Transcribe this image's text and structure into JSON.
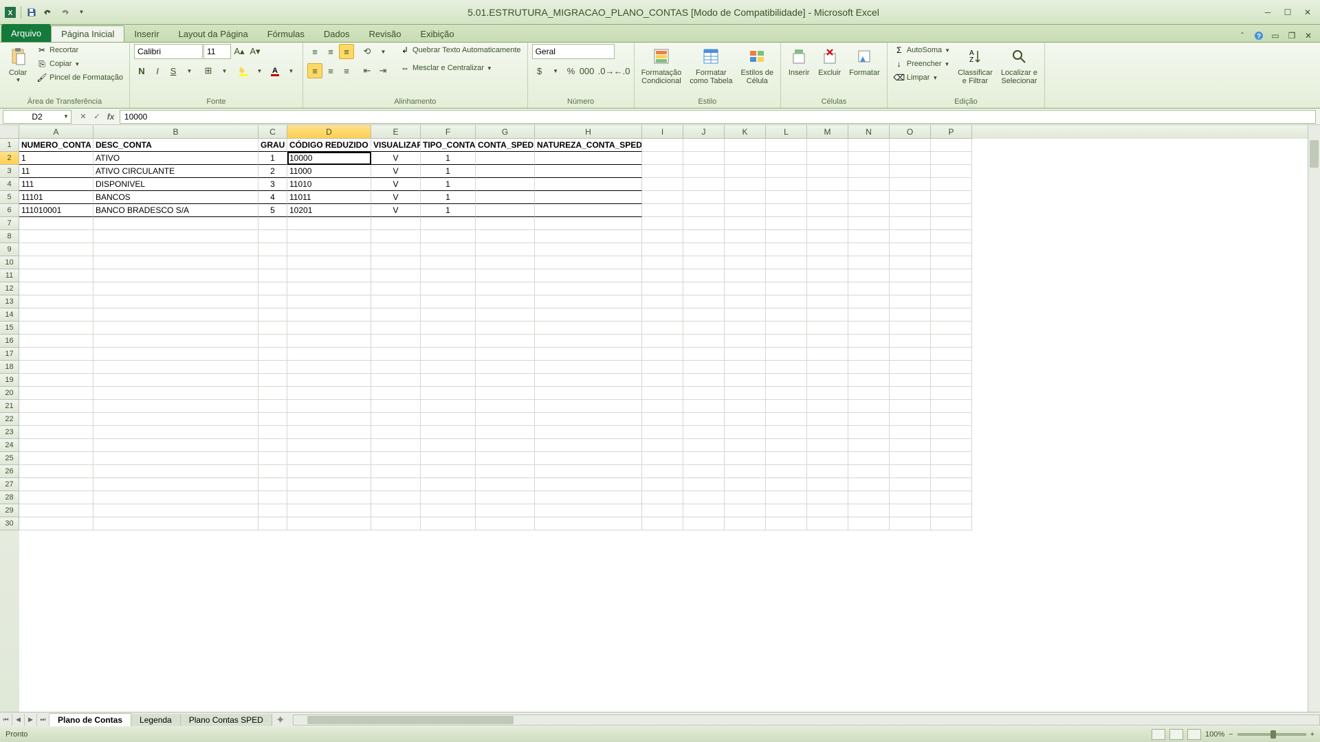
{
  "title": "5.01.ESTRUTURA_MIGRACAO_PLANO_CONTAS [Modo de Compatibilidade] - Microsoft Excel",
  "tabs": {
    "file": "Arquivo",
    "home": "Página Inicial",
    "insert": "Inserir",
    "layout": "Layout da Página",
    "formulas": "Fórmulas",
    "data": "Dados",
    "review": "Revisão",
    "view": "Exibição"
  },
  "ribbon": {
    "clipboard": {
      "paste": "Colar",
      "cut": "Recortar",
      "copy": "Copiar",
      "painter": "Pincel de Formatação",
      "group": "Área de Transferência"
    },
    "font": {
      "name": "Calibri",
      "size": "11",
      "group": "Fonte"
    },
    "align": {
      "wrap": "Quebrar Texto Automaticamente",
      "merge": "Mesclar e Centralizar",
      "group": "Alinhamento"
    },
    "number": {
      "format": "Geral",
      "group": "Número"
    },
    "styles": {
      "cond": "Formatação\nCondicional",
      "table": "Formatar\ncomo Tabela",
      "cell": "Estilos de\nCélula",
      "group": "Estilo"
    },
    "cells": {
      "insert": "Inserir",
      "delete": "Excluir",
      "format": "Formatar",
      "group": "Células"
    },
    "editing": {
      "sum": "AutoSoma",
      "fill": "Preencher",
      "clear": "Limpar",
      "sort": "Classificar\ne Filtrar",
      "find": "Localizar e\nSelecionar",
      "group": "Edição"
    }
  },
  "namebox": "D2",
  "formula": "10000",
  "columns": {
    "labels": [
      "A",
      "B",
      "C",
      "D",
      "E",
      "F",
      "G",
      "H",
      "I",
      "J",
      "K",
      "L",
      "M",
      "N",
      "O",
      "P"
    ],
    "widths": [
      108,
      240,
      42,
      122,
      72,
      80,
      86,
      156,
      60,
      60,
      60,
      60,
      60,
      60,
      60,
      60
    ]
  },
  "headers": [
    "NUMERO_CONTA",
    "DESC_CONTA",
    "GRAU",
    "CÓDIGO REDUZIDO",
    "VISUALIZAR",
    "TIPO_CONTA",
    "CONTA_SPED",
    "NATUREZA_CONTA_SPED"
  ],
  "rows": [
    {
      "a": "1",
      "b": "ATIVO",
      "c": "1",
      "d": "10000",
      "e": "V",
      "f": "1",
      "g": "",
      "h": ""
    },
    {
      "a": "11",
      "b": "ATIVO CIRCULANTE",
      "c": "2",
      "d": "11000",
      "e": "V",
      "f": "1",
      "g": "",
      "h": ""
    },
    {
      "a": "111",
      "b": "DISPONIVEL",
      "c": "3",
      "d": "11010",
      "e": "V",
      "f": "1",
      "g": "",
      "h": ""
    },
    {
      "a": "11101",
      "b": "BANCOS",
      "c": "4",
      "d": "11011",
      "e": "V",
      "f": "1",
      "g": "",
      "h": ""
    },
    {
      "a": "111010001",
      "b": "BANCO BRADESCO S/A",
      "c": "5",
      "d": "10201",
      "e": "V",
      "f": "1",
      "g": "",
      "h": ""
    }
  ],
  "sheets": [
    "Plano de Contas",
    "Legenda",
    "Plano Contas SPED"
  ],
  "status": "Pronto",
  "zoom": "100%"
}
